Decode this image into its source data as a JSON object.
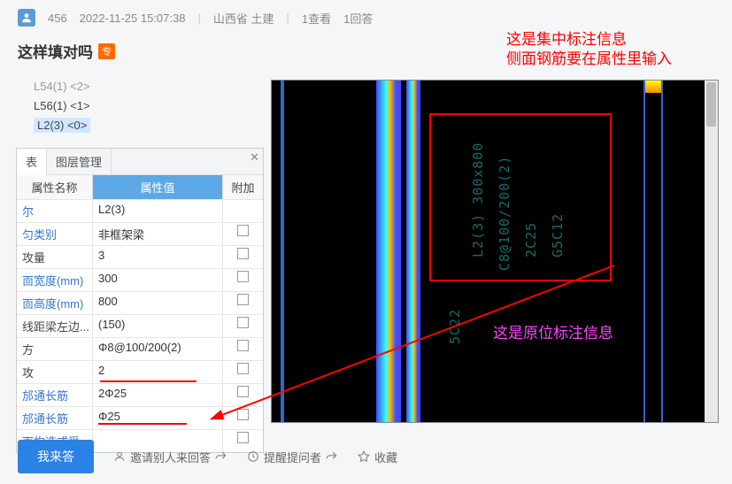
{
  "header": {
    "user": "456",
    "time": "2022-11-25 15:07:38",
    "loc": "山西省  土建",
    "views": "1查看",
    "answers": "1回答"
  },
  "title": "这样填对吗",
  "badge": "专",
  "list": {
    "i0": "L54(1) <2>",
    "i1": "L56(1) <1>",
    "i2": "L2(3) <0>"
  },
  "tabs": {
    "t1": "表",
    "t2": "图层管理"
  },
  "propHead": {
    "c1": "属性名称",
    "c2": "属性值",
    "c3": "附加"
  },
  "rows": {
    "r0": {
      "n": "尔",
      "v": "L2(3)"
    },
    "r1": {
      "n": "匀类别",
      "v": "非框架梁"
    },
    "r2": {
      "n": "攻量",
      "v": "3"
    },
    "r3": {
      "n": "靣宽度(mm)",
      "v": "300"
    },
    "r4": {
      "n": "靣高度(mm)",
      "v": "800"
    },
    "r5": {
      "n": "线距梁左边...",
      "v": "(150)"
    },
    "r6": {
      "n": "方",
      "v": "Φ8@100/200(2)"
    },
    "r7": {
      "n": "攻",
      "v": "2"
    },
    "r8": {
      "n": "邡通长筋",
      "v": "2Φ25"
    },
    "r9": {
      "n": "邡通长筋",
      "v": "Φ25"
    },
    "r10": {
      "n": "靣构造或受..."
    }
  },
  "anno": {
    "red1": "这是集中标注信息",
    "red2": "侧面钢筋要在属性里输入",
    "pink": "这是原位标注信息"
  },
  "cad": {
    "t1": "L2(3) 300x800",
    "t2": "C8@100/200(2)",
    "t3": "2C25",
    "t4": "G5C12",
    "t5": "5C22"
  },
  "footer": {
    "btn": "我来答",
    "invite": "邀请别人来回答",
    "remind": "提醒提问者",
    "fav": "收藏"
  }
}
